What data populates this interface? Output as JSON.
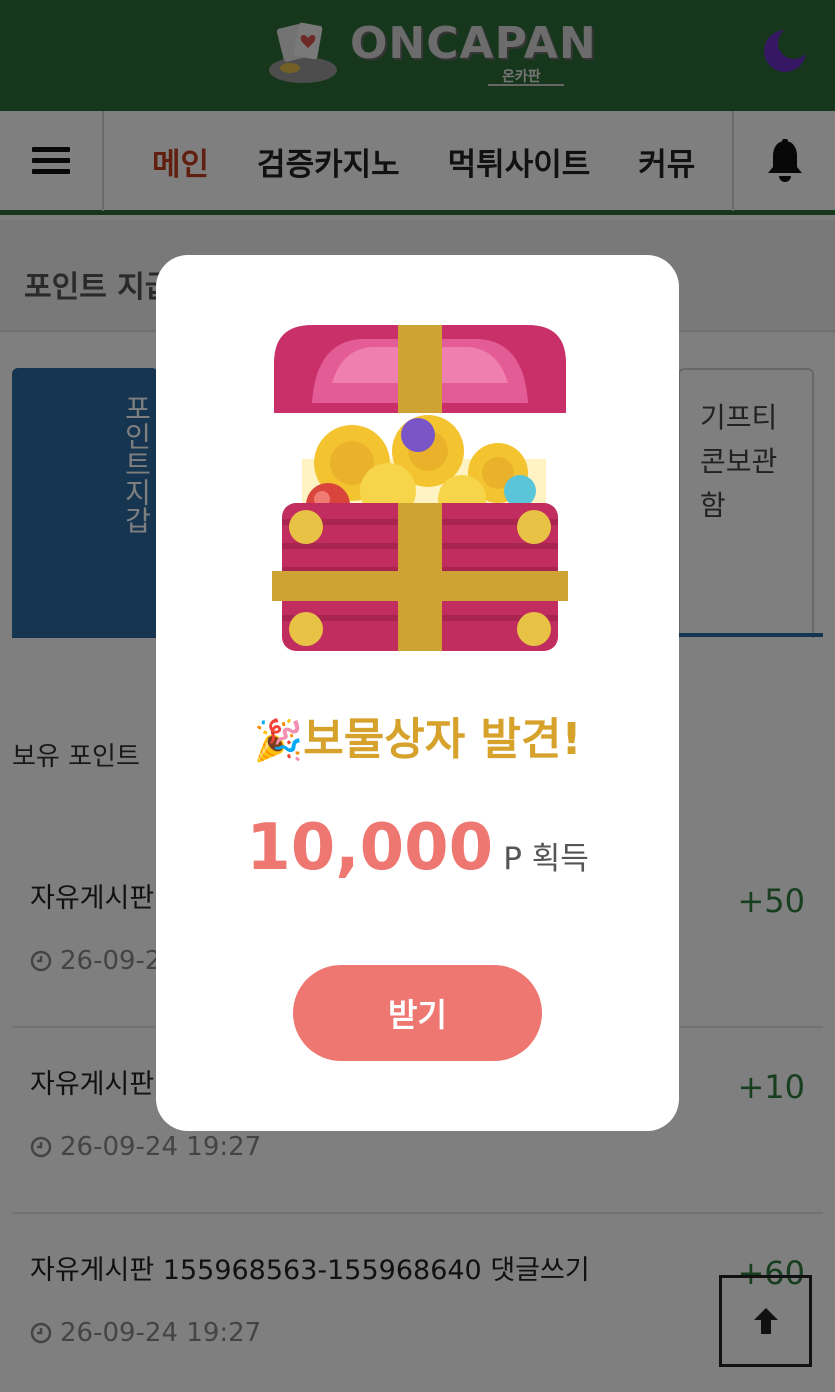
{
  "header": {
    "logo_text": "ONCAPAN",
    "logo_sub": "온카판",
    "theme_icon": "moon-icon",
    "brand_color": "#2e6f3b"
  },
  "nav": {
    "menu_icon": "hamburger-icon",
    "items": [
      {
        "label": "메인",
        "active": true
      },
      {
        "label": "검증카지노"
      },
      {
        "label": "먹튀사이트"
      },
      {
        "label": "커뮤"
      }
    ],
    "bell_icon": "bell-icon"
  },
  "subhead": {
    "title": "포인트 지급"
  },
  "tabs": {
    "wallet": "포인트지갑",
    "gift": "기프티콘보관함"
  },
  "owned_label": "보유 포인트",
  "rows": [
    {
      "title": "자유게시판",
      "date": "26-09-2",
      "points": "+50"
    },
    {
      "title": "자유게시판",
      "date": "26-09-24 19:27",
      "points": "+10"
    },
    {
      "title": "자유게시판 155968563-155968640 댓글쓰기",
      "date": "26-09-24 19:27",
      "points": "+60"
    }
  ],
  "modal": {
    "party_emoji": "🎉",
    "title": "보물상자 발견!",
    "amount": "10,000",
    "unit": "P 획득",
    "claim_label": "받기",
    "accent_color": "#ef7772",
    "title_color": "#d6a22b"
  },
  "scroll_top_icon": "arrow-up-icon"
}
